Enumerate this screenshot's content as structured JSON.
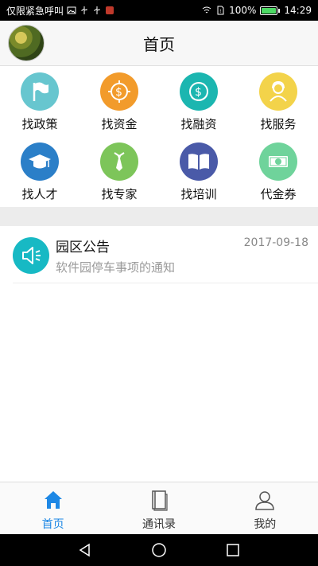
{
  "status_bar": {
    "carrier_text": "仅限紧急呼叫",
    "battery": "100%",
    "battery_level": 1.0,
    "time": "14:29"
  },
  "header": {
    "title": "首页"
  },
  "grid": [
    {
      "label": "找政策",
      "icon": "flag-icon",
      "color": "#67c6cf"
    },
    {
      "label": "找资金",
      "icon": "coin-icon",
      "color": "#f29b2b"
    },
    {
      "label": "找融资",
      "icon": "money-exchange-icon",
      "color": "#1bb6b0"
    },
    {
      "label": "找服务",
      "icon": "service-person-icon",
      "color": "#f3d34a"
    },
    {
      "label": "找人才",
      "icon": "graduation-cap-icon",
      "color": "#2b7fc8"
    },
    {
      "label": "找专家",
      "icon": "tie-icon",
      "color": "#7dc55a"
    },
    {
      "label": "找培训",
      "icon": "book-icon",
      "color": "#4a5aa8"
    },
    {
      "label": "代金券",
      "icon": "voucher-icon",
      "color": "#6fd39b"
    }
  ],
  "notice": {
    "title": "园区公告",
    "date": "2017-09-18",
    "subtitle": "软件园停车事项的通知",
    "icon": "speaker-icon"
  },
  "tabs": [
    {
      "label": "首页",
      "icon": "home-icon",
      "active": true
    },
    {
      "label": "通讯录",
      "icon": "contacts-book-icon",
      "active": false
    },
    {
      "label": "我的",
      "icon": "user-icon",
      "active": false
    }
  ],
  "colors": {
    "accent": "#1e88e5",
    "notice_icon_bg": "#17b9c4"
  }
}
